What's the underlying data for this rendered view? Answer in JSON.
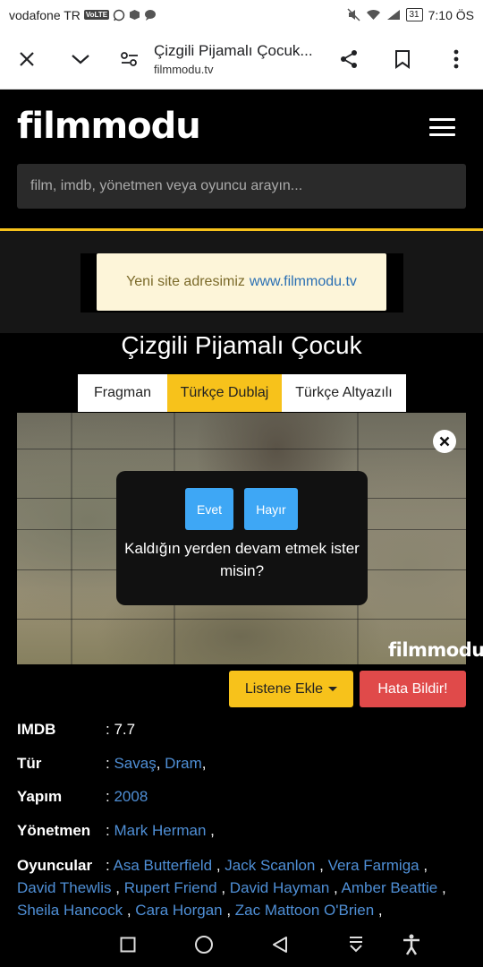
{
  "status_bar": {
    "carrier": "vodafone TR",
    "volte": "VoLTE",
    "battery": "31",
    "time": "7:10 ÖS"
  },
  "browser": {
    "title": "Çizgili Pijamalı Çocuk...",
    "url": "filmmodu.tv"
  },
  "site": {
    "logo": "filmmodu",
    "search_placeholder": "film, imdb, yönetmen veya oyuncu arayın...",
    "notice_text": "Yeni site adresimiz",
    "notice_link": "www.filmmodu.tv",
    "accent_color": "#f7c21b"
  },
  "movie": {
    "title": "Çizgili Pijamalı Çocuk",
    "tabs": [
      {
        "label": "Fragman",
        "active": false
      },
      {
        "label": "Türkçe Dublaj",
        "active": true
      },
      {
        "label": "Türkçe Altyazılı",
        "active": false
      }
    ]
  },
  "player": {
    "watermark": "filmmodu",
    "resume_yes": "Evet",
    "resume_no": "Hayır",
    "resume_question": "Kaldığın yerden devam etmek ister misin?"
  },
  "actions": {
    "add_to_list": "Listene Ekle",
    "report": "Hata Bildir!"
  },
  "details": {
    "imdb_label": "IMDB",
    "imdb_value": ": 7.7",
    "genre_label": "Tür",
    "genre_prefix": ":",
    "genres": [
      "Savaş",
      "Dram"
    ],
    "year_label": "Yapım",
    "year_prefix": ":",
    "year": "2008",
    "director_label": "Yönetmen",
    "director_prefix": ":",
    "director": "Mark Herman",
    "cast_label": "Oyuncular",
    "cast_prefix": ":",
    "cast": [
      "Asa Butterfield",
      "Jack Scanlon",
      "Vera Farmiga",
      "David Thewlis",
      "Rupert Friend",
      "David Hayman",
      "Amber Beattie",
      "Sheila Hancock",
      "Cara Horgan",
      "Zac Mattoon O'Brien"
    ]
  }
}
